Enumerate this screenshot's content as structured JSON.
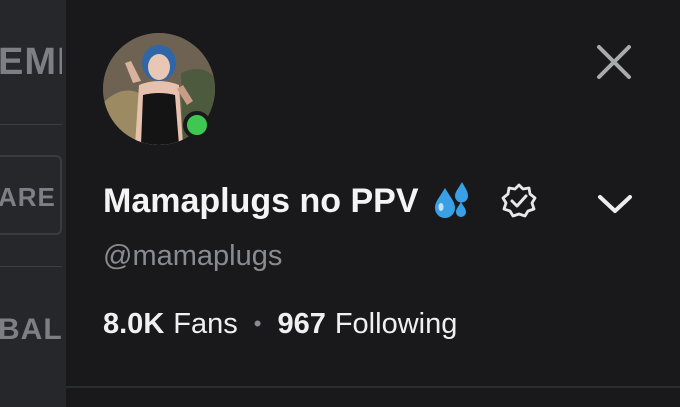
{
  "background": {
    "row1_text": "EMI",
    "row2_text": "ARE I",
    "row3_text": "BAL"
  },
  "profile": {
    "display_name": "Mamaplugs no PPV",
    "emoji_icon": "sweat-droplets-icon",
    "verified_icon": "verified-badge-icon",
    "handle": "@mamaplugs",
    "online_status_color": "#3fc851",
    "fans_count": "8.0K",
    "fans_label": "Fans",
    "separator": "•",
    "following_count": "967",
    "following_label": "Following"
  },
  "actions": {
    "close_icon": "close-icon",
    "expand_icon": "chevron-down-icon"
  },
  "colors": {
    "drawer_bg": "#19191b",
    "text_primary": "#f4f4f4",
    "text_secondary": "#8a8b90",
    "emoji_blue": "#3aa0e6"
  }
}
